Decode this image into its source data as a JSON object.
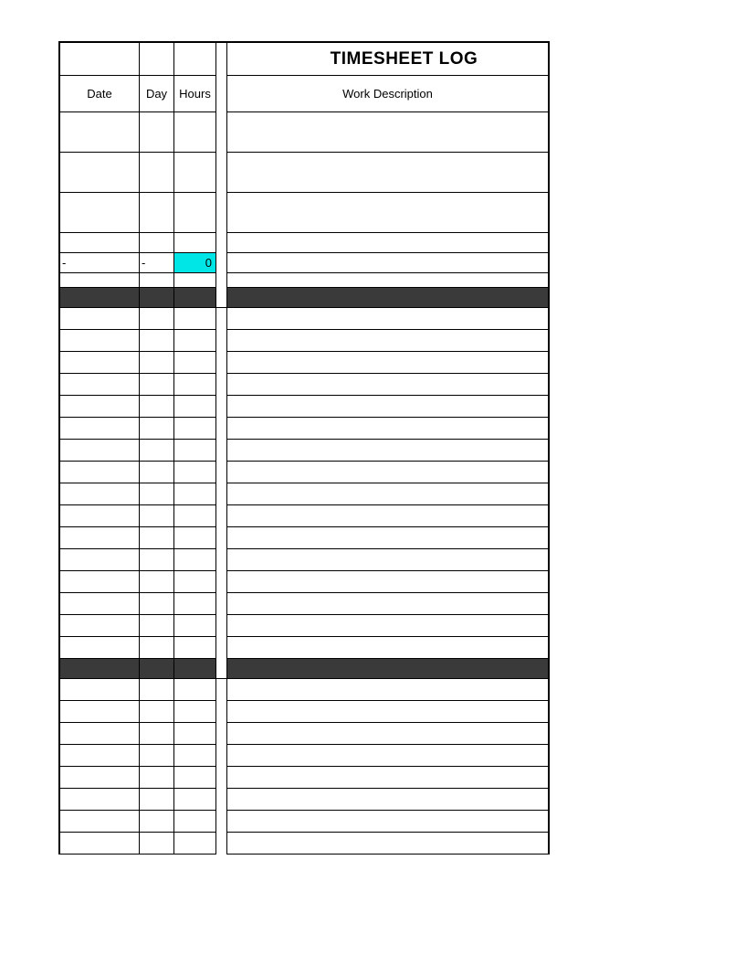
{
  "title": "TIMESHEET LOG",
  "columns": {
    "date": "Date",
    "day": "Day",
    "hours": "Hours",
    "description": "Work Description"
  },
  "section1": {
    "rows": [
      {
        "date": "",
        "day": "",
        "hours": "",
        "description": ""
      },
      {
        "date": "",
        "day": "",
        "hours": "",
        "description": ""
      },
      {
        "date": "",
        "day": "",
        "hours": "",
        "description": ""
      },
      {
        "date": "",
        "day": "",
        "hours": "",
        "description": ""
      }
    ],
    "summary": {
      "date": "-",
      "day": "-",
      "hours": "0",
      "description": ""
    }
  },
  "section2": {
    "rows": [
      {
        "date": "",
        "day": "",
        "hours": "",
        "description": ""
      },
      {
        "date": "",
        "day": "",
        "hours": "",
        "description": ""
      },
      {
        "date": "",
        "day": "",
        "hours": "",
        "description": ""
      },
      {
        "date": "",
        "day": "",
        "hours": "",
        "description": ""
      },
      {
        "date": "",
        "day": "",
        "hours": "",
        "description": ""
      },
      {
        "date": "",
        "day": "",
        "hours": "",
        "description": ""
      },
      {
        "date": "",
        "day": "",
        "hours": "",
        "description": ""
      },
      {
        "date": "",
        "day": "",
        "hours": "",
        "description": ""
      },
      {
        "date": "",
        "day": "",
        "hours": "",
        "description": ""
      },
      {
        "date": "",
        "day": "",
        "hours": "",
        "description": ""
      },
      {
        "date": "",
        "day": "",
        "hours": "",
        "description": ""
      },
      {
        "date": "",
        "day": "",
        "hours": "",
        "description": ""
      },
      {
        "date": "",
        "day": "",
        "hours": "",
        "description": ""
      },
      {
        "date": "",
        "day": "",
        "hours": "",
        "description": ""
      },
      {
        "date": "",
        "day": "",
        "hours": "",
        "description": ""
      },
      {
        "date": "",
        "day": "",
        "hours": "",
        "description": ""
      }
    ]
  },
  "section3": {
    "rows": [
      {
        "date": "",
        "day": "",
        "hours": "",
        "description": ""
      },
      {
        "date": "",
        "day": "",
        "hours": "",
        "description": ""
      },
      {
        "date": "",
        "day": "",
        "hours": "",
        "description": ""
      },
      {
        "date": "",
        "day": "",
        "hours": "",
        "description": ""
      },
      {
        "date": "",
        "day": "",
        "hours": "",
        "description": ""
      },
      {
        "date": "",
        "day": "",
        "hours": "",
        "description": ""
      },
      {
        "date": "",
        "day": "",
        "hours": "",
        "description": ""
      },
      {
        "date": "",
        "day": "",
        "hours": "",
        "description": ""
      }
    ]
  }
}
